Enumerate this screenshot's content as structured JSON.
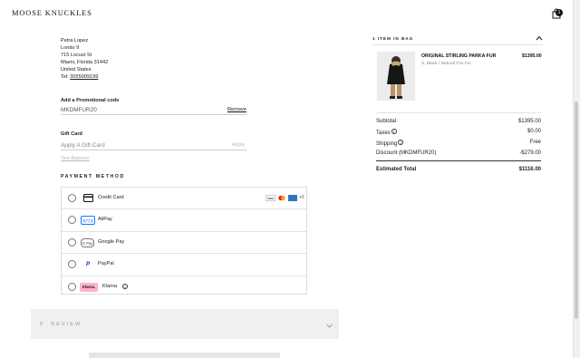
{
  "header": {
    "logo": "MOOSE KNUCKLES",
    "cart_count": "1"
  },
  "shipping_address": {
    "name": "Petra Lopez",
    "line1": "Londo 9",
    "line2": "715 Locust St",
    "line3": "Miami, Florida 31442",
    "country": "United States",
    "tel_label": "Tel:",
    "tel": "3055009199"
  },
  "promo": {
    "label": "Add a Promotional code",
    "value": "MKDMFUR20",
    "remove": "Remove"
  },
  "gift_card": {
    "label": "Gift Card",
    "placeholder": "Apply A Gift Card",
    "apply": "Apply",
    "see_balance": "See Balance"
  },
  "payment": {
    "title": "PAYMENT METHOD",
    "methods": [
      {
        "name": "Credit Card",
        "icon": "credit-card-icon"
      },
      {
        "name": "AliPay",
        "icon": "alipay-logo",
        "logo_text": "支付宝"
      },
      {
        "name": "Google Pay",
        "icon": "google-pay-logo",
        "logo_text": "G Pay"
      },
      {
        "name": "PayPal",
        "icon": "paypal-logo",
        "logo_text": "P"
      },
      {
        "name": "Klarna",
        "icon": "klarna-logo",
        "logo_text": "Klarna."
      }
    ],
    "card_brands": [
      "VISA",
      "mastercard",
      "amex"
    ],
    "more_cards": "+5"
  },
  "review": {
    "step": "6",
    "label": "REVIEW"
  },
  "bag": {
    "title": "1 ITEM IN BAG",
    "product": {
      "name": "ORIGINAL STIRLING PARKA FUR",
      "variant": "S, Black / Natural Fox Fur",
      "price": "$1395.00"
    }
  },
  "summary": {
    "subtotal_label": "Subtotal",
    "subtotal": "$1395.00",
    "taxes_label": "Taxes",
    "taxes": "$0.00",
    "shipping_label": "Shipping",
    "shipping": "Free",
    "discount_label": "Discount (MKDMFUR20)",
    "discount": "-$279.00",
    "total_label": "Estimated Total",
    "total": "$1116.00"
  },
  "colors": {
    "accent": "#111111",
    "klarna_pink": "#ffb3c7",
    "paypal_blue": "#003087",
    "amex_blue": "#2e77bc"
  }
}
